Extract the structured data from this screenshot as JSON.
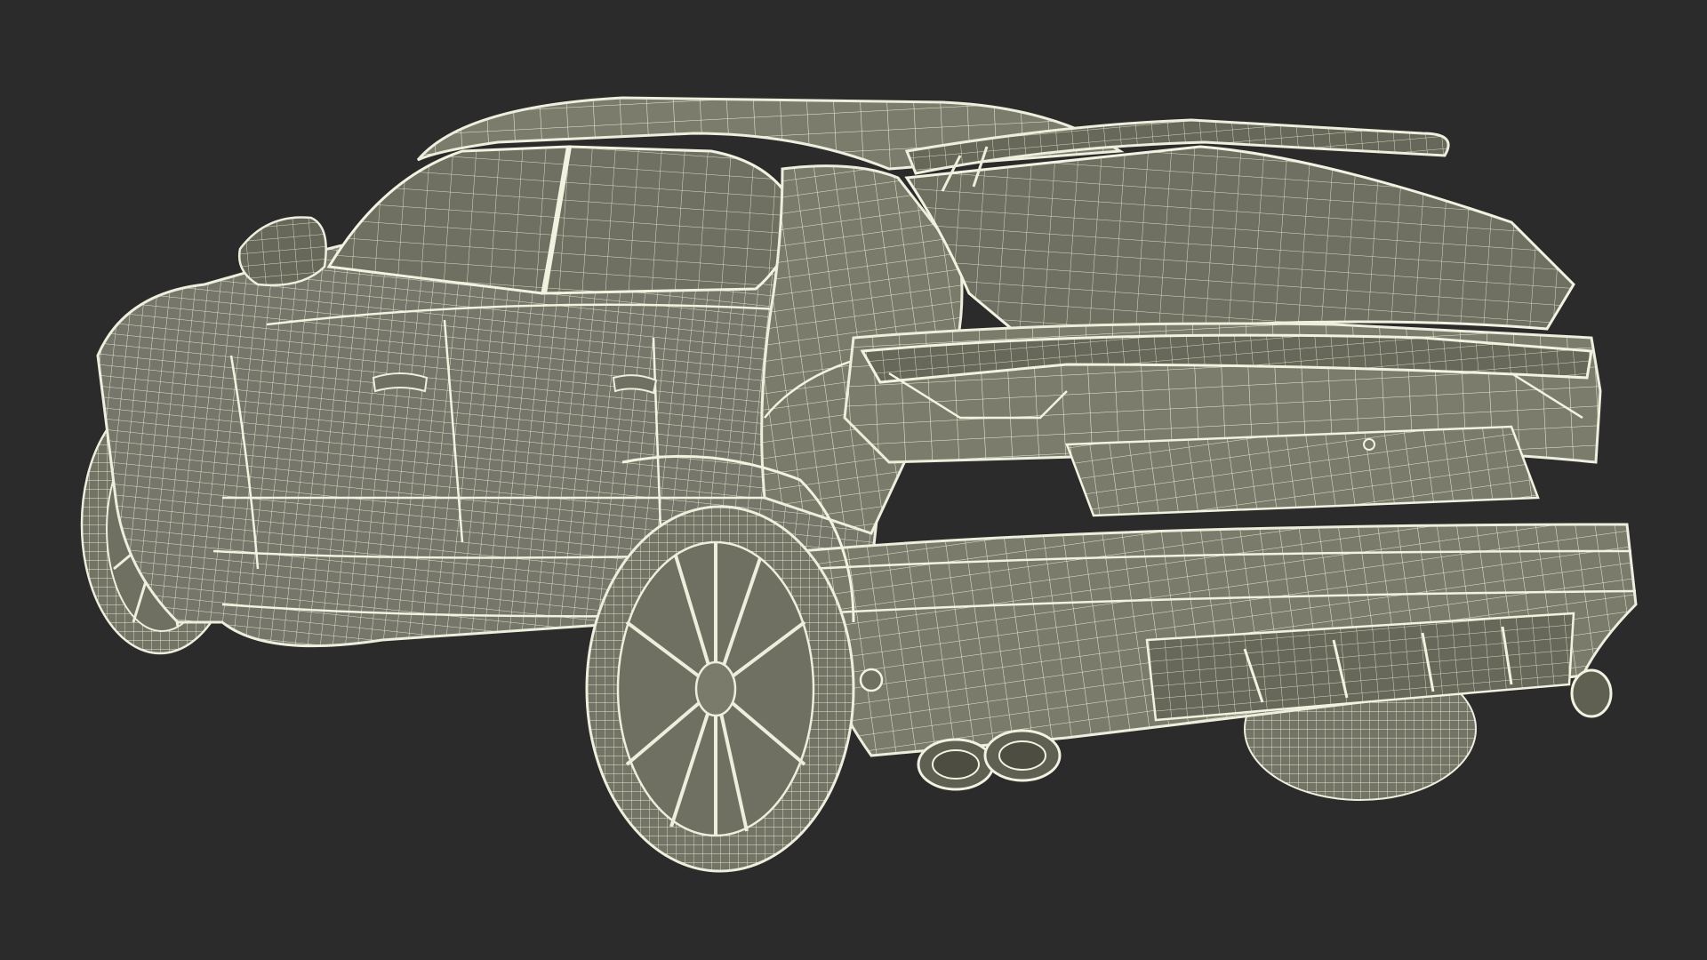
{
  "viewport": {
    "content": "wireframe-render",
    "subject": "car-rear-three-quarter",
    "colors": {
      "background": "#2b2b2b",
      "surface": "#7b7b6c",
      "surface_dark": "#676758",
      "glass": "#707062",
      "wire": "#eeeedc",
      "wire_soft": "#d8d8c4"
    }
  }
}
